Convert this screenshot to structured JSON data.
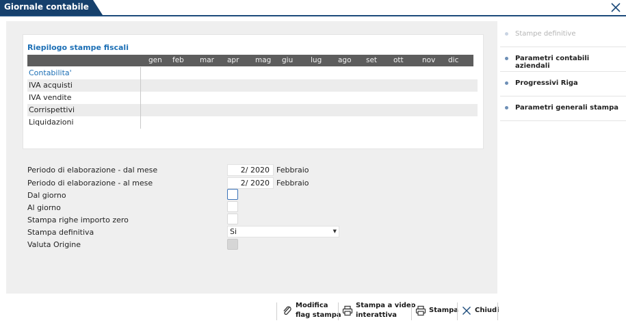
{
  "window": {
    "title": "Giornale contabile",
    "close_icon": "close-icon"
  },
  "summary": {
    "title": "Riepilogo stampe fiscali",
    "months": [
      "gen",
      "feb",
      "mar",
      "apr",
      "mag",
      "giu",
      "lug",
      "ago",
      "set",
      "ott",
      "nov",
      "dic"
    ],
    "rows": [
      {
        "label": "Contabilita'",
        "active": true
      },
      {
        "label": "IVA acquisti"
      },
      {
        "label": "IVA vendite"
      },
      {
        "label": "Corrispettivi"
      },
      {
        "label": "Liquidazioni"
      }
    ]
  },
  "form": {
    "period_from": {
      "label": "Periodo di elaborazione - dal mese",
      "value": "2/ 2020",
      "month": "Febbraio"
    },
    "period_to": {
      "label": "Periodo di elaborazione - al mese",
      "value": "2/ 2020",
      "month": "Febbraio"
    },
    "from_day": {
      "label": "Dal giorno",
      "value": ""
    },
    "to_day": {
      "label": "Al giorno",
      "value": ""
    },
    "zero_rows": {
      "label": "Stampa righe importo zero",
      "value": ""
    },
    "definitive": {
      "label": "Stampa definitiva",
      "value": "Si"
    },
    "currency": {
      "label": "Valuta Origine",
      "value": ""
    }
  },
  "side_panel": {
    "items": [
      {
        "label": "Stampe definitive",
        "disabled": true
      },
      {
        "label": "Parametri contabili aziendali"
      },
      {
        "label": "Progressivi Riga"
      },
      {
        "label": "Parametri generali stampa"
      }
    ]
  },
  "toolbar": {
    "modify_l1": "Modifica",
    "modify_l2": "flag stampa",
    "video_l1": "Stampa a video",
    "video_l2": "interattiva",
    "print": "Stampa",
    "close": "Chiudi"
  },
  "colors": {
    "accent": "#16406c",
    "link": "#1c6fb5",
    "header_bg": "#5d5d5d",
    "panel_bg": "#efefef"
  }
}
